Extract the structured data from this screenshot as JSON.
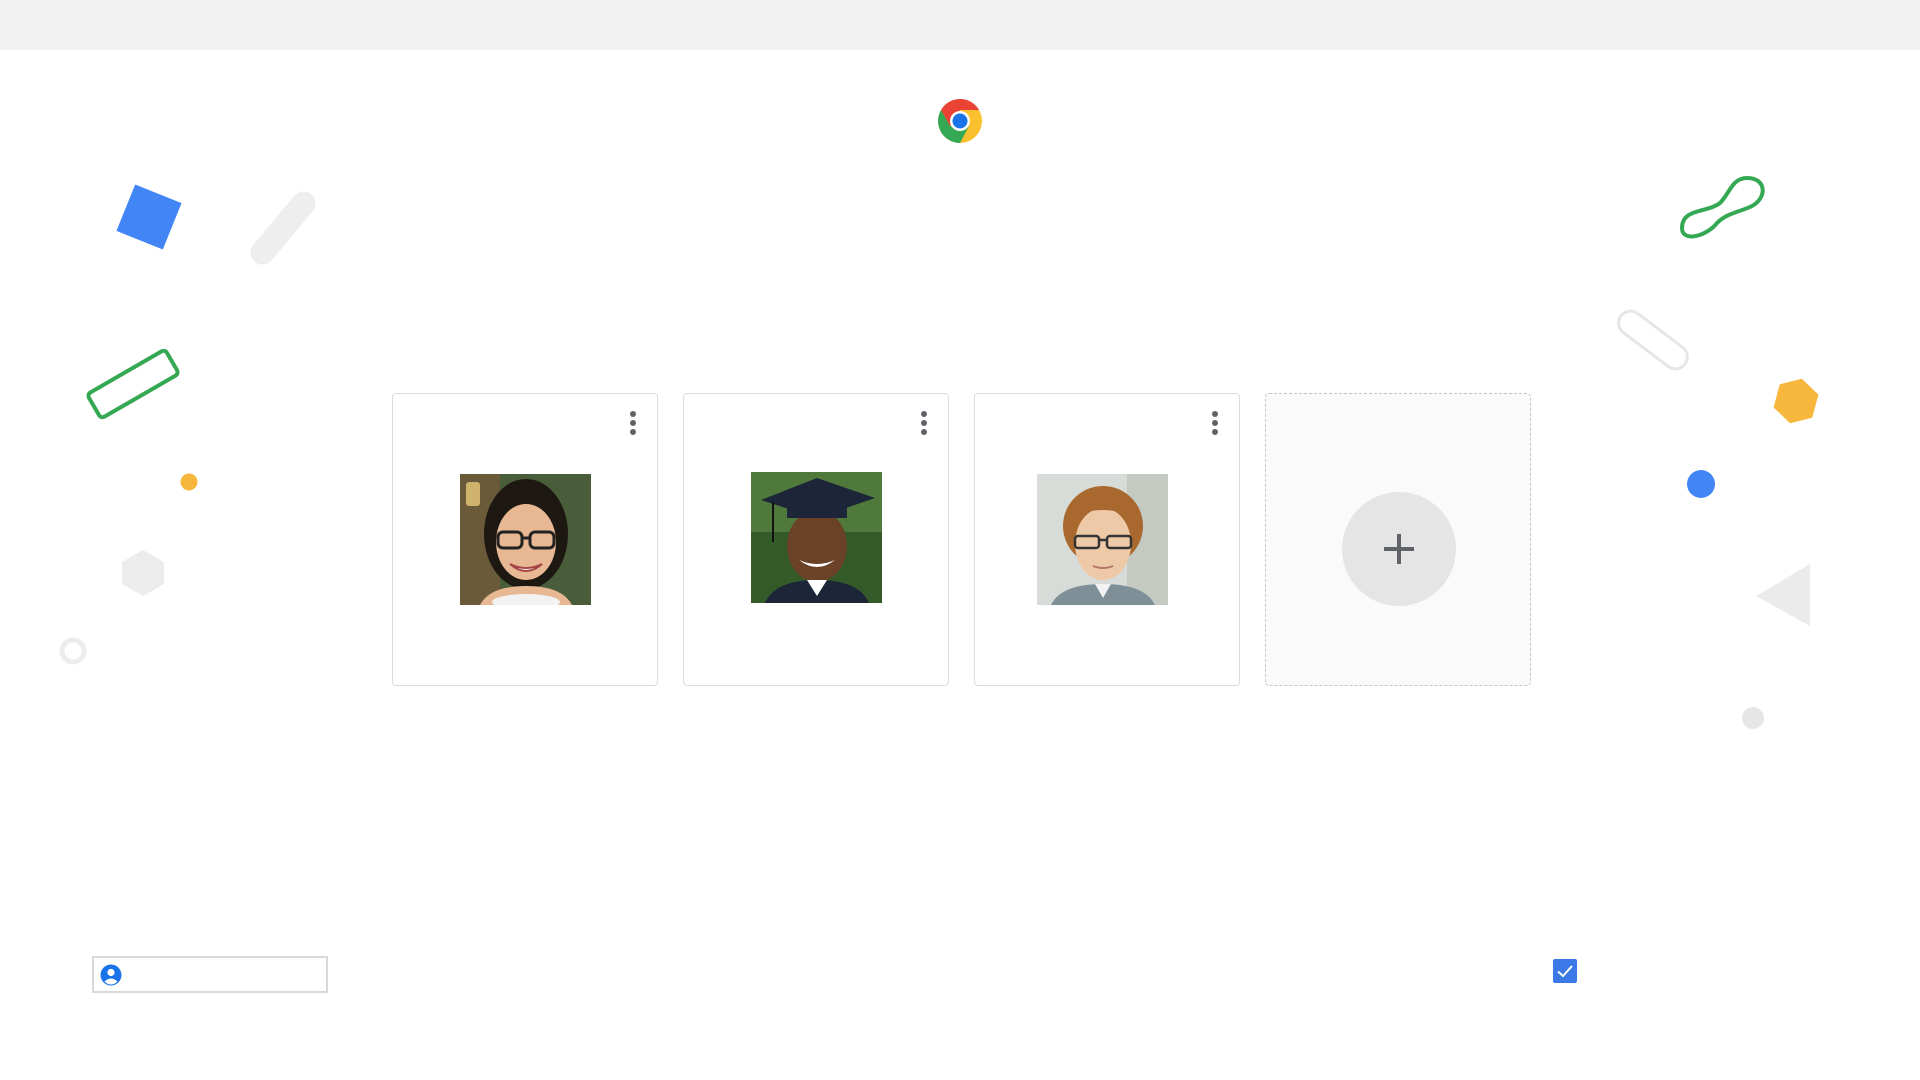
{
  "app": {
    "logo": "chrome-logo-icon"
  },
  "colors": {
    "accent_blue": "#4285f4",
    "accent_green": "#34a853",
    "accent_yellow": "#fbbc05",
    "accent_red": "#ea4335",
    "light_gray": "#e8e8e8"
  },
  "profiles": [
    {
      "avatar": "woman-with-glasses-avatar",
      "menu_icon": "more-vert-icon"
    },
    {
      "avatar": "graduate-man-avatar",
      "menu_icon": "more-vert-icon"
    },
    {
      "avatar": "man-with-glasses-avatar",
      "menu_icon": "more-vert-icon"
    }
  ],
  "add_profile": {
    "icon": "plus-icon"
  },
  "profile_name": {
    "value": "",
    "placeholder": "",
    "icon": "person-icon"
  },
  "checkbox": {
    "checked": true,
    "icon": "check-icon"
  }
}
